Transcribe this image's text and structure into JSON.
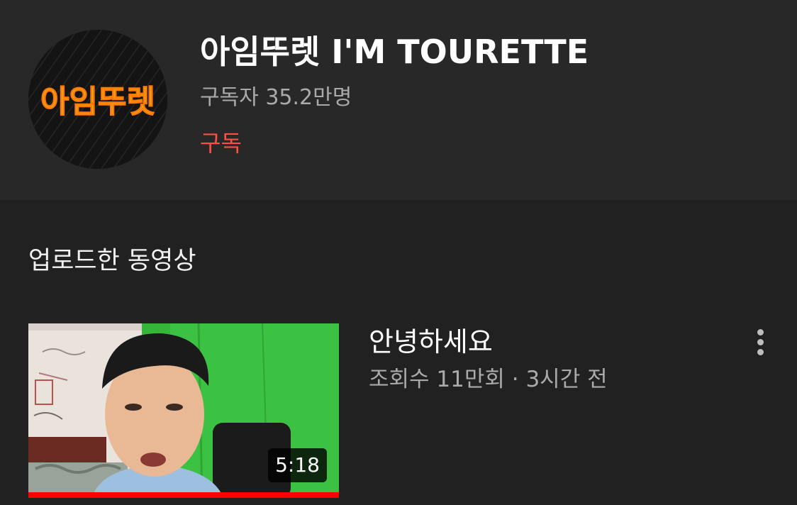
{
  "channel": {
    "name": "아임뚜렛 I'M TOURETTE",
    "avatar_text": "아임뚜렛",
    "subscribers": "구독자 35.2만명",
    "subscribe_label": "구독"
  },
  "uploads": {
    "section_title": "업로드한 동영상",
    "videos": [
      {
        "title": "안녕하세요",
        "stats": "조회수 11만회 · 3시간 전",
        "duration": "5:18",
        "watch_progress": 1.0
      }
    ]
  },
  "colors": {
    "background": "#212121",
    "header_background": "#282828",
    "subscribe_accent": "#ff4e45",
    "progress": "#ff0000",
    "secondary_text": "#aaaaaa"
  },
  "icons": {
    "more": "more-vert-icon"
  }
}
